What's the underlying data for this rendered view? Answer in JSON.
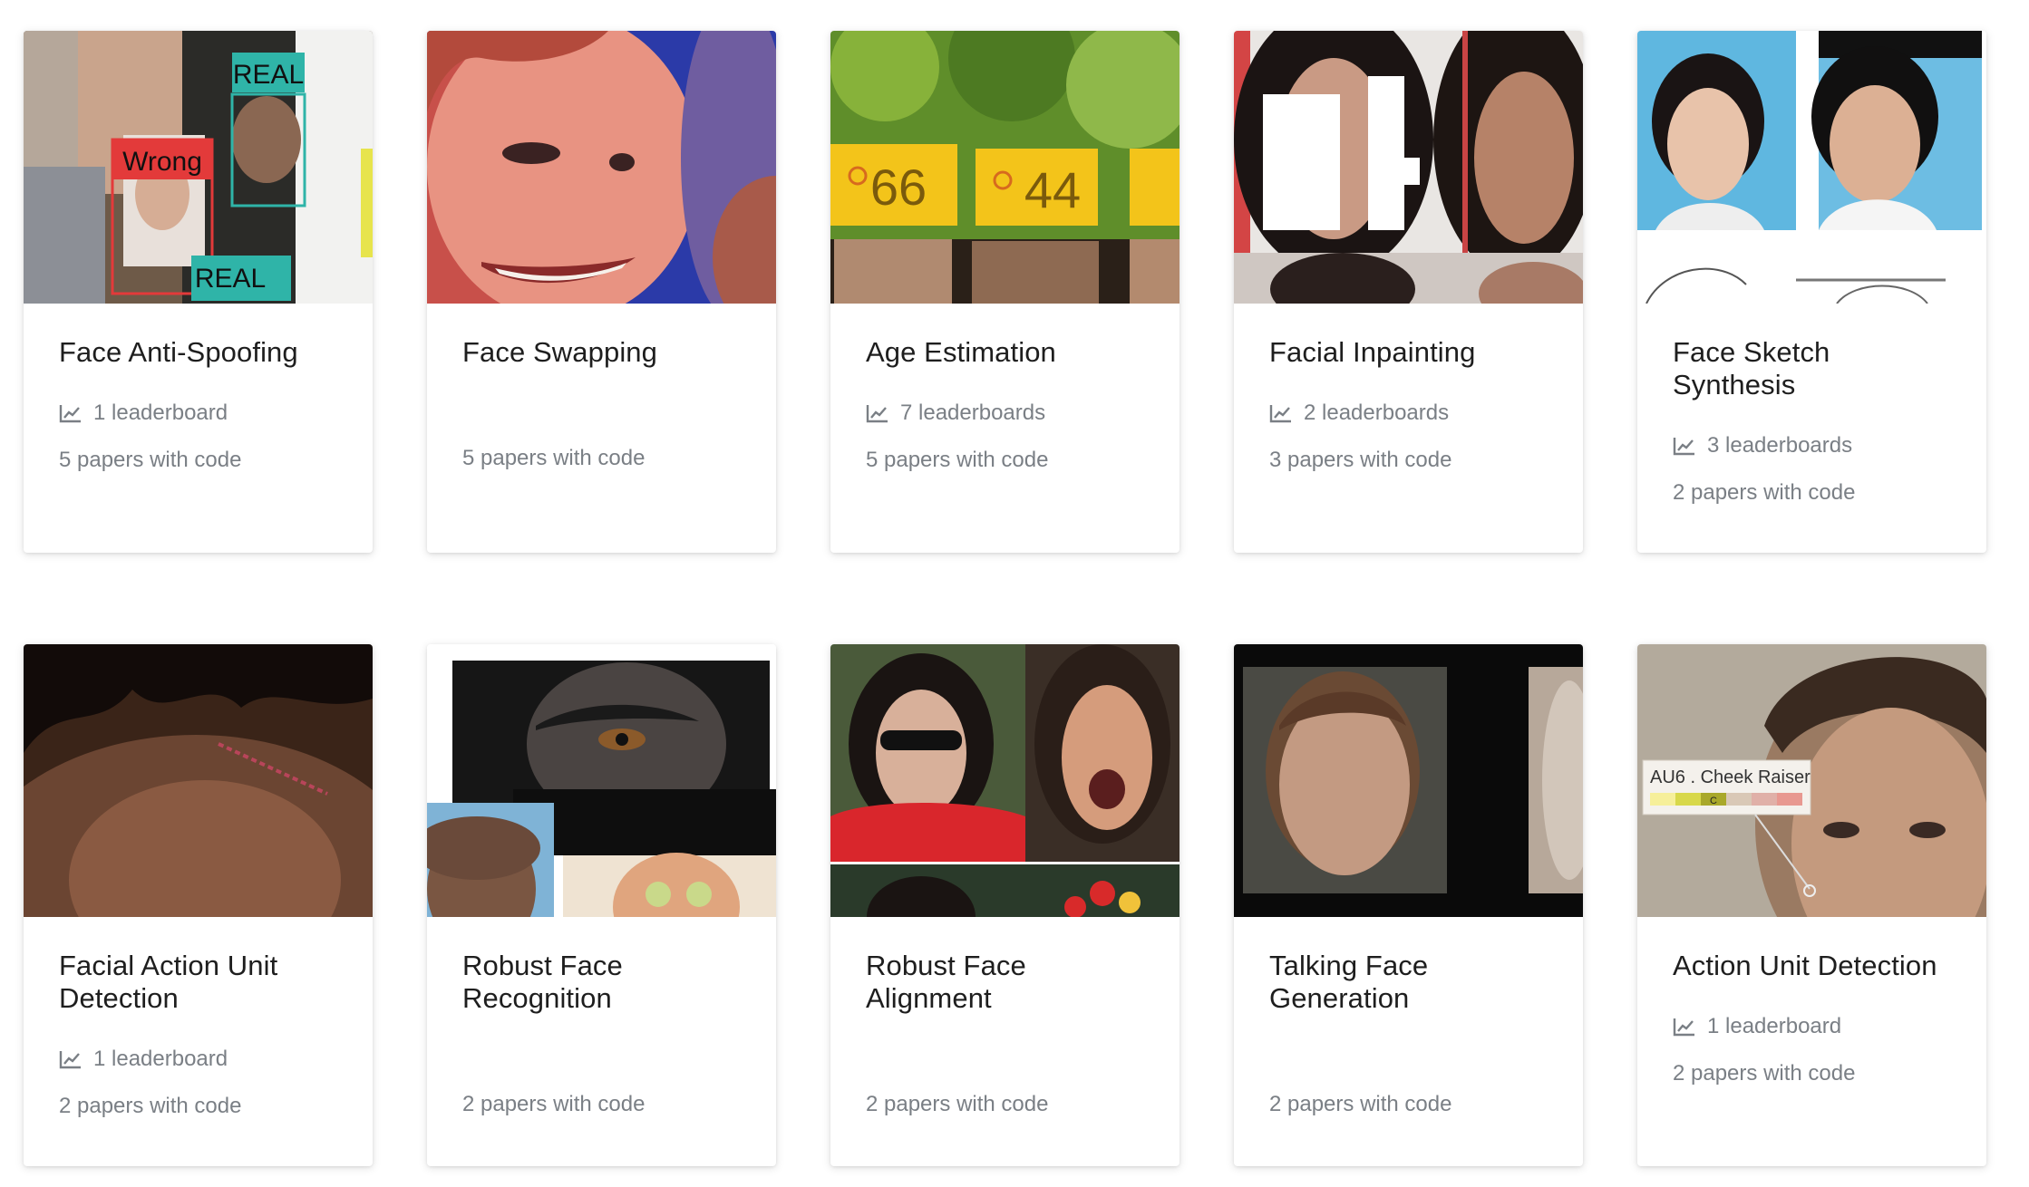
{
  "cards": [
    {
      "title": "Face Anti-Spoofing",
      "leaderboards": "1 leaderboard",
      "papers": "5 papers with code",
      "image_labels": [
        "REAL",
        "Wrong",
        "REAL"
      ]
    },
    {
      "title": "Face Swapping",
      "leaderboards": "",
      "papers": "5 papers with code"
    },
    {
      "title": "Age Estimation",
      "leaderboards": "7 leaderboards",
      "papers": "5 papers with code",
      "image_labels": [
        "66",
        "44"
      ]
    },
    {
      "title": "Facial Inpainting",
      "leaderboards": "2 leaderboards",
      "papers": "3 papers with code"
    },
    {
      "title": "Face Sketch Synthesis",
      "leaderboards": "3 leaderboards",
      "papers": "2 papers with code"
    },
    {
      "title": "Facial Action Unit Detection",
      "leaderboards": "1 leaderboard",
      "papers": "2 papers with code"
    },
    {
      "title": "Robust Face Recognition",
      "leaderboards": "",
      "papers": "2 papers with code"
    },
    {
      "title": "Robust Face Alignment",
      "leaderboards": "",
      "papers": "2 papers with code"
    },
    {
      "title": "Talking Face Generation",
      "leaderboards": "",
      "papers": "2 papers with code"
    },
    {
      "title": "Action Unit Detection",
      "leaderboards": "1 leaderboard",
      "papers": "2 papers with code",
      "image_labels": [
        "AU6 . Cheek Raiser",
        "C"
      ]
    }
  ],
  "icons": {
    "leaderboard": "line-chart-icon"
  },
  "colors": {
    "title": "#1e1e1e",
    "meta": "#7a7f85",
    "accent_teal": "#2fb4a8",
    "accent_red": "#e33a3a",
    "age_badge": "#f3c41a"
  }
}
